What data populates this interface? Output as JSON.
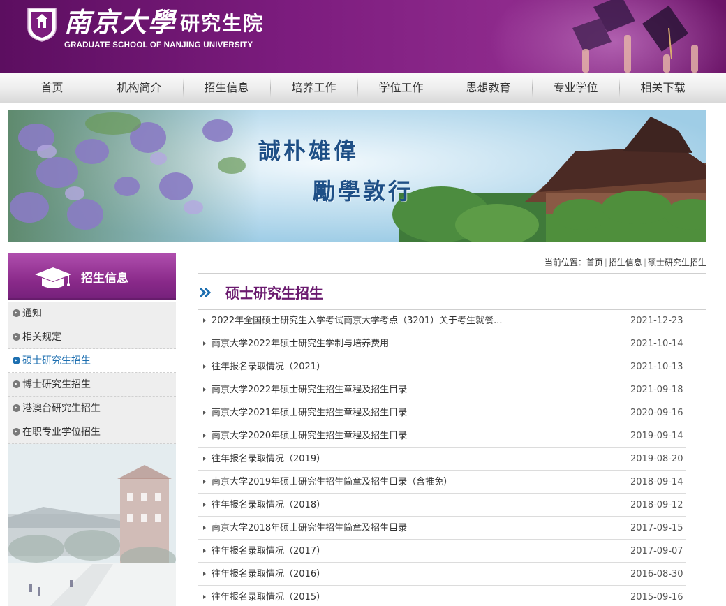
{
  "header": {
    "name_cn": "南京大學",
    "school_cn": "研究生院",
    "name_en": "GRADUATE SCHOOL OF NANJING UNIVERSITY",
    "accent": "#7c1c7e"
  },
  "nav": {
    "items": [
      {
        "label": "首页"
      },
      {
        "label": "机构简介"
      },
      {
        "label": "招生信息"
      },
      {
        "label": "培养工作"
      },
      {
        "label": "学位工作"
      },
      {
        "label": "思想教育"
      },
      {
        "label": "专业学位"
      },
      {
        "label": "相关下载"
      }
    ]
  },
  "banner": {
    "motto_line1": "誠朴雄偉",
    "motto_line2": "勵學敦行"
  },
  "sidebar": {
    "title": "招生信息",
    "icon": "graduation-cap-icon",
    "items": [
      {
        "label": "通知",
        "active": false
      },
      {
        "label": "相关规定",
        "active": false
      },
      {
        "label": "硕士研究生招生",
        "active": true
      },
      {
        "label": "博士研究生招生",
        "active": false
      },
      {
        "label": "港澳台研究生招生",
        "active": false
      },
      {
        "label": "在职专业学位招生",
        "active": false
      }
    ]
  },
  "breadcrumb": {
    "prefix": "当前位置：",
    "items": [
      "首页",
      "招生信息",
      "硕士研究生招生"
    ]
  },
  "main": {
    "section_title": "硕士研究生招生",
    "news": [
      {
        "title": "2022年全国硕士研究生入学考试南京大学考点（3201）关于考生就餐...",
        "date": "2021-12-23"
      },
      {
        "title": "南京大学2022年硕士研究生学制与培养费用",
        "date": "2021-10-14"
      },
      {
        "title": "往年报名录取情况（2021）",
        "date": "2021-10-13"
      },
      {
        "title": "南京大学2022年硕士研究生招生章程及招生目录",
        "date": "2021-09-18"
      },
      {
        "title": "南京大学2021年硕士研究生招生章程及招生目录",
        "date": "2020-09-16"
      },
      {
        "title": "南京大学2020年硕士研究生招生章程及招生目录",
        "date": "2019-09-14"
      },
      {
        "title": "往年报名录取情况（2019）",
        "date": "2019-08-20"
      },
      {
        "title": "南京大学2019年硕士研究生招生简章及招生目录（含推免）",
        "date": "2018-09-14"
      },
      {
        "title": "往年报名录取情况（2018）",
        "date": "2018-09-12"
      },
      {
        "title": "南京大学2018年硕士研究生招生简章及招生目录",
        "date": "2017-09-15"
      },
      {
        "title": "往年报名录取情况（2017）",
        "date": "2017-09-07"
      },
      {
        "title": "往年报名录取情况（2016）",
        "date": "2016-08-30"
      },
      {
        "title": "往年报名录取情况（2015）",
        "date": "2015-09-16"
      }
    ]
  }
}
